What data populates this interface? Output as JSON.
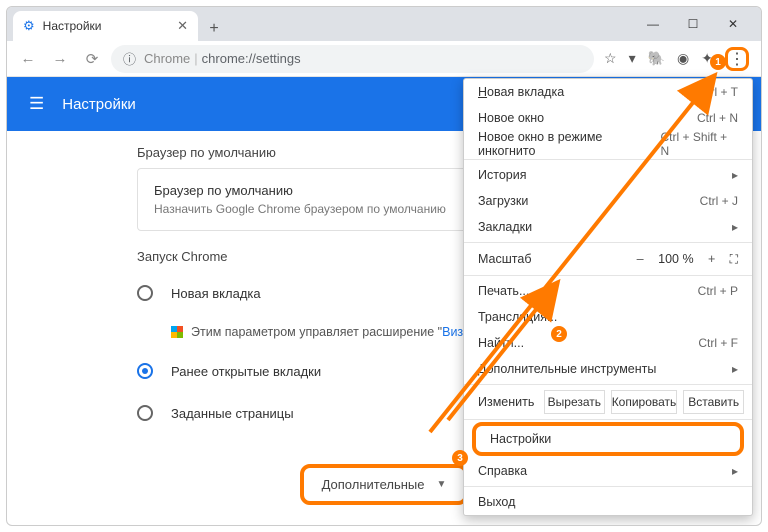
{
  "tab": {
    "title": "Настройки"
  },
  "omnibox": {
    "prefix": "Chrome",
    "url": "chrome://settings"
  },
  "bluebar": {
    "title": "Настройки"
  },
  "sections": {
    "default_browser": {
      "heading": "Браузер по умолчанию",
      "card_title": "Браузер по умолчанию",
      "card_sub": "Назначить Google Chrome браузером по умолчанию"
    },
    "startup": {
      "heading": "Запуск Chrome",
      "opt_new": "Новая вкладка",
      "managed_prefix": "Этим параметром управляет расширение \"",
      "managed_link": "Визуаль",
      "opt_prev": "Ранее открытые вкладки",
      "opt_pages": "Заданные страницы"
    }
  },
  "advanced": {
    "label": "Дополнительные"
  },
  "menu": {
    "new_tab": "Новая вкладка",
    "sc_new_tab": "Ctrl + T",
    "new_window": "Новое окно",
    "sc_new_window": "Ctrl + N",
    "incognito": "Новое окно в режиме инкогнито",
    "sc_incognito": "Ctrl + Shift + N",
    "history": "История",
    "downloads": "Загрузки",
    "sc_downloads": "Ctrl + J",
    "bookmarks": "Закладки",
    "zoom_label": "Масштаб",
    "zoom_val": "100 %",
    "print": "Печать...",
    "sc_print": "Ctrl + P",
    "cast": "Трансляция...",
    "find": "Найти...",
    "sc_find": "Ctrl + F",
    "more_tools": "Дополнительные инструменты",
    "edit_label": "Изменить",
    "cut": "Вырезать",
    "copy": "Копировать",
    "paste": "Вставить",
    "settings": "Настройки",
    "help": "Справка",
    "exit": "Выход"
  },
  "badges": {
    "b1": "1",
    "b2": "2",
    "b3": "3"
  }
}
